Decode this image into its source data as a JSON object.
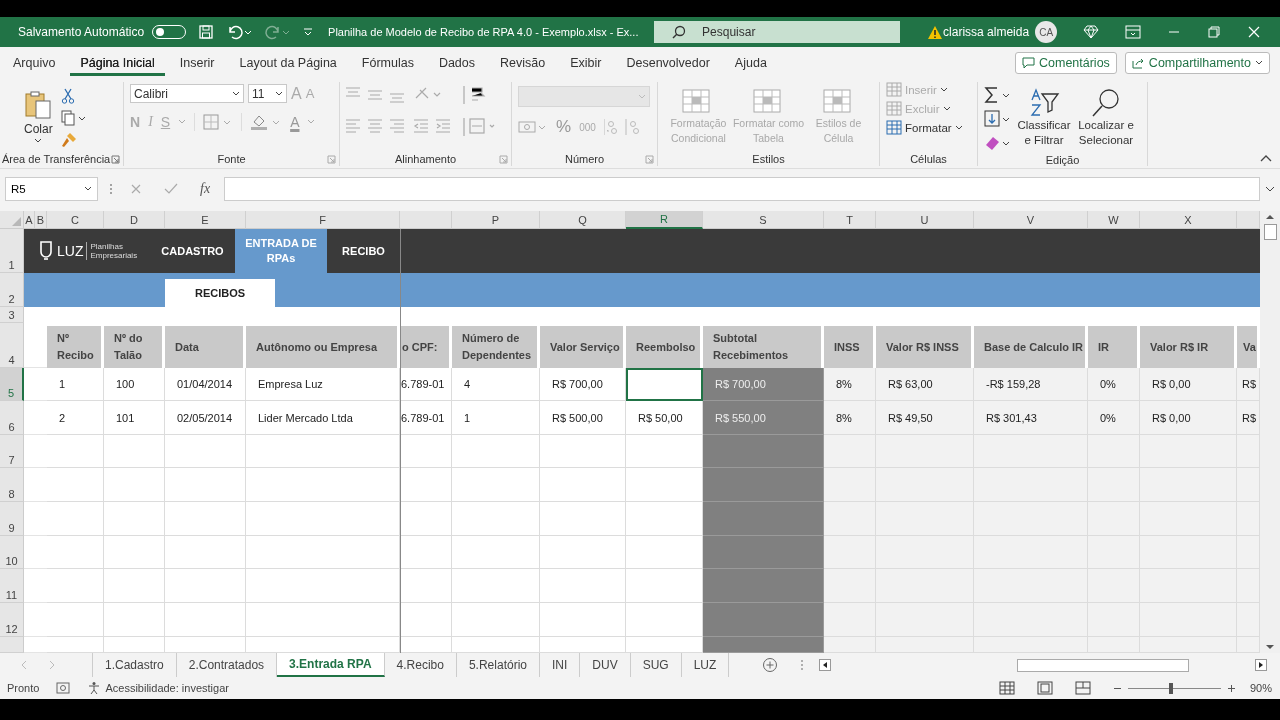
{
  "title_bar": {
    "autosave_label": "Salvamento Automático",
    "autosave_on": false,
    "document_title": "Planilha de Modelo de Recibo de RPA 4.0 - Exemplo.xlsx  -  Ex...",
    "search_placeholder": "Pesquisar",
    "user_name": "clarissa almeida",
    "user_initials": "CA"
  },
  "menu_tabs": [
    {
      "label": "Arquivo",
      "selected": false
    },
    {
      "label": "Página Inicial",
      "selected": true
    },
    {
      "label": "Inserir",
      "selected": false
    },
    {
      "label": "Layout da Página",
      "selected": false
    },
    {
      "label": "Fórmulas",
      "selected": false
    },
    {
      "label": "Dados",
      "selected": false
    },
    {
      "label": "Revisão",
      "selected": false
    },
    {
      "label": "Exibir",
      "selected": false
    },
    {
      "label": "Desenvolvedor",
      "selected": false
    },
    {
      "label": "Ajuda",
      "selected": false
    }
  ],
  "menu_buttons": [
    "Comentários",
    "Compartilhamento"
  ],
  "ribbon": {
    "clipboard": {
      "paste": "Colar",
      "group": "Área de Transferência"
    },
    "font": {
      "name": "Calibri",
      "size": "11",
      "bold": "N",
      "italic": "I",
      "underline": "S",
      "grow": "A",
      "shrink": "A",
      "color_letter": "A",
      "group": "Fonte"
    },
    "alignment": {
      "group": "Alinhamento"
    },
    "number": {
      "percent": "%",
      "thousands": "000",
      "group": "Número"
    },
    "styles": {
      "buttons": [
        {
          "label": "Formatação\nCondicional",
          "disabled": true
        },
        {
          "label": "Formatar como\nTabela",
          "disabled": true
        },
        {
          "label": "Estilos de\nCélula",
          "disabled": true
        }
      ],
      "group": "Estilos"
    },
    "cells": {
      "buttons": [
        {
          "label": "Inserir",
          "disabled": true
        },
        {
          "label": "Excluir",
          "disabled": true
        },
        {
          "label": "Formatar",
          "disabled": false
        }
      ],
      "group": "Células"
    },
    "editing": {
      "sort": "Classificar\ne Filtrar",
      "find": "Localizar e\nSelecionar",
      "group": "Edição"
    }
  },
  "formula_bar": {
    "name_box": "R5",
    "fx": "fx"
  },
  "columns": [
    {
      "letter": "A",
      "selected": false
    },
    {
      "letter": "B",
      "selected": false
    },
    {
      "letter": "C",
      "selected": false
    },
    {
      "letter": "D",
      "selected": false
    },
    {
      "letter": "E",
      "selected": false
    },
    {
      "letter": "F",
      "selected": false
    },
    {
      "selected": false
    },
    {
      "letter": "P",
      "selected": false
    },
    {
      "letter": "Q",
      "selected": false
    },
    {
      "letter": "R",
      "selected": true
    },
    {
      "letter": "S",
      "selected": false
    },
    {
      "letter": "T",
      "selected": false
    },
    {
      "letter": "U",
      "selected": false
    },
    {
      "letter": "V",
      "selected": false
    },
    {
      "letter": "W",
      "selected": false
    },
    {
      "letter": "X",
      "selected": false
    },
    {
      "selected": false
    }
  ],
  "row_numbers": [
    {
      "label": "1",
      "selected": false
    },
    {
      "label": "2",
      "selected": false
    },
    {
      "label": "3",
      "selected": false
    },
    {
      "label": "4",
      "selected": false
    },
    {
      "label": "5",
      "selected": true
    },
    {
      "label": "6",
      "selected": false
    },
    {
      "label": "7",
      "selected": false
    },
    {
      "label": "8",
      "selected": false
    },
    {
      "label": "9",
      "selected": false
    },
    {
      "label": "10",
      "selected": false
    },
    {
      "label": "11",
      "selected": false
    },
    {
      "label": "12",
      "selected": false
    }
  ],
  "banner": {
    "logo": "LUZ",
    "logo_subtitle": "Planilhas Empresariais",
    "nav": [
      {
        "label": "CADASTRO",
        "selected": false
      },
      {
        "label": "ENTRADA DE\nRPAs",
        "selected": true
      },
      {
        "label": "RECIBO",
        "selected": false
      }
    ],
    "subtab": "RECIBOS"
  },
  "table": {
    "headers": [
      {
        "label": "Nº\nRecibo",
        "kind": "input"
      },
      {
        "label": "Nº do\nTalão",
        "kind": "input"
      },
      {
        "label": "Data",
        "kind": "input"
      },
      {
        "label": "Autônomo ou Empresa",
        "kind": "input"
      },
      {
        "label": "o CPF:",
        "kind": "input"
      },
      {
        "label": "Número de\nDependentes",
        "kind": "input"
      },
      {
        "label": "Valor Serviço",
        "kind": "input"
      },
      {
        "label": "Reembolso",
        "kind": "input"
      },
      {
        "label": "Subtotal\nRecebimentos",
        "kind": "subtotal"
      },
      {
        "label": "INSS",
        "kind": "calc"
      },
      {
        "label": "Valor R$ INSS",
        "kind": "calc"
      },
      {
        "label": "Base de Calculo IR",
        "kind": "calc"
      },
      {
        "label": "IR",
        "kind": "calc"
      },
      {
        "label": "Valor R$ IR",
        "kind": "calc"
      },
      {
        "label": "Va",
        "kind": "calc"
      }
    ],
    "rows": [
      [
        "1",
        "100",
        "01/04/2014",
        "Empresa Luz",
        "6.789-01",
        "4",
        "R$ 700,00",
        null,
        "R$ 700,00",
        "8%",
        "R$ 63,00",
        "-R$ 159,28",
        "0%",
        "R$ 0,00",
        "R$"
      ],
      [
        "2",
        "101",
        "02/05/2014",
        "Lider Mercado Ltda",
        "6.789-01",
        "1",
        "R$ 500,00",
        "R$ 50,00",
        "R$ 550,00",
        "8%",
        "R$ 49,50",
        "R$ 301,43",
        "0%",
        "R$ 0,00",
        "R$"
      ]
    ]
  },
  "sheet_tabs": [
    {
      "label": "1.Cadastro",
      "selected": false
    },
    {
      "label": "2.Contratados",
      "selected": false
    },
    {
      "label": "3.Entrada RPA",
      "selected": true
    },
    {
      "label": "4.Recibo",
      "selected": false
    },
    {
      "label": "5.Relatório",
      "selected": false
    },
    {
      "label": "INI",
      "selected": false
    },
    {
      "label": "DUV",
      "selected": false
    },
    {
      "label": "SUG",
      "selected": false
    },
    {
      "label": "LUZ",
      "selected": false
    }
  ],
  "status_bar": {
    "ready": "Pronto",
    "accessibility": "Acessibilidade: investigar",
    "zoom": "90%",
    "zoom_slider": {
      "level": 0.46
    }
  }
}
